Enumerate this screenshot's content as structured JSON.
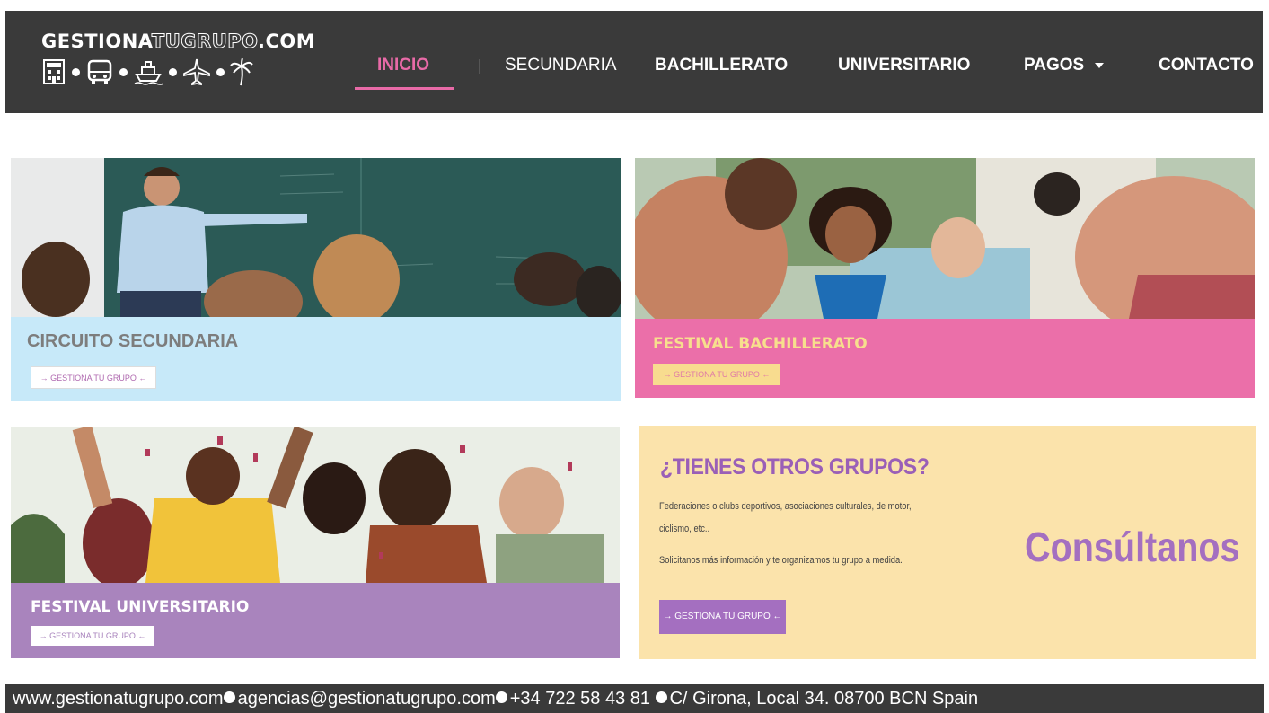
{
  "header": {
    "logo": {
      "part1": "GESTIONA",
      "part2": "TUGRUPO",
      "part3": ".COM"
    },
    "icons": [
      "hotel-icon",
      "bus-icon",
      "ship-icon",
      "plane-icon",
      "palm-tree-icon"
    ],
    "nav": [
      {
        "label": "INICIO",
        "active": true
      },
      {
        "label": "SECUNDARIA",
        "active": false
      },
      {
        "label": "BACHILLERATO",
        "active": false
      },
      {
        "label": "UNIVERSITARIO",
        "active": false
      },
      {
        "label": "PAGOS",
        "active": false,
        "dropdown": true
      },
      {
        "label": "CONTACTO",
        "active": false
      }
    ],
    "colors": {
      "bg": "#3a3a3a",
      "accent": "#e86aa7"
    }
  },
  "cards": [
    {
      "title": "CIRCUITO SECUNDARIA",
      "cta": "→ GESTIONA TU GRUPO ←",
      "band_color": "#c7e9f9"
    },
    {
      "title": "FESTIVAL BACHILLERATO",
      "cta": "→ GESTIONA TU GRUPO ←",
      "band_color": "#eb6fa9"
    },
    {
      "title": "FESTIVAL UNIVERSITARIO",
      "cta": "→ GESTIONA TU GRUPO ←",
      "band_color": "#a984bd"
    },
    {
      "title": "¿TIENES OTROS GRUPOS?",
      "text1": "Federaciones o clubs deportivos, asociaciones culturales, de motor,",
      "text2": "ciclismo, etc..",
      "text3": "Solicitanos más información y te organizamos tu grupo a medida.",
      "consult": "Consúltanos",
      "cta": "→ GESTIONA TU GRUPO ←",
      "band_color": "#fbe3ab"
    }
  ],
  "footer": {
    "website": "www.gestionatugrupo.com",
    "email": "agencias@gestionatugrupo.com",
    "phone": "+34 722 58 43 81",
    "address": "C/ Girona, Local 34. 08700 BCN Spain"
  }
}
